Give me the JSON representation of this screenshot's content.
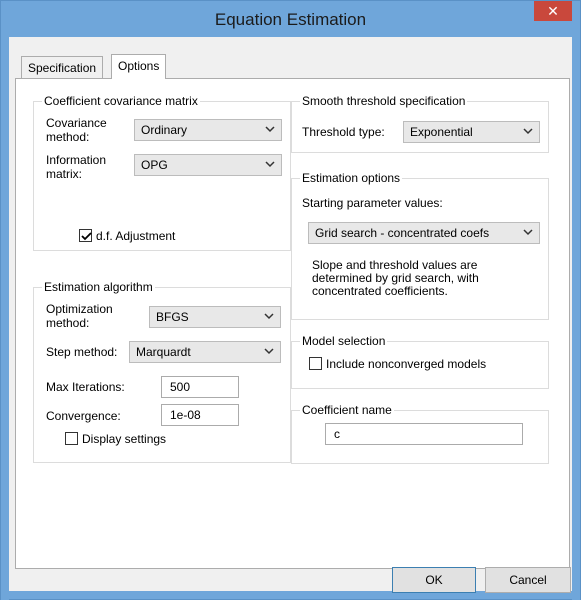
{
  "window": {
    "title": "Equation Estimation"
  },
  "tabs": [
    {
      "label": "Specification",
      "active": false
    },
    {
      "label": "Options",
      "active": true
    }
  ],
  "covariance": {
    "group_label": "Coefficient covariance matrix",
    "method_label_line1": "Covariance",
    "method_label_line2": "method:",
    "method_value": "Ordinary",
    "info_label_line1": "Information",
    "info_label_line2": "matrix:",
    "info_value": "OPG",
    "df_label": "d.f. Adjustment",
    "df_checked": true
  },
  "algorithm": {
    "group_label": "Estimation algorithm",
    "opt_label_line1": "Optimization",
    "opt_label_line2": "method:",
    "opt_value": "BFGS",
    "step_label": "Step method:",
    "step_value": "Marquardt",
    "maxiter_label": "Max Iterations:",
    "maxiter_value": "500",
    "conv_label": "Convergence:",
    "conv_value": "1e-08",
    "display_label": "Display settings",
    "display_checked": false
  },
  "threshold": {
    "group_label": "Smooth threshold specification",
    "type_label": "Threshold type:",
    "type_value": "Exponential"
  },
  "estimation_options": {
    "group_label": "Estimation options",
    "start_label": "Starting parameter values:",
    "start_value": "Grid search - concentrated coefs",
    "desc_line1": "Slope and threshold values are",
    "desc_line2": "determined by grid search, with",
    "desc_line3": "concentrated coefficients."
  },
  "model_selection": {
    "group_label": "Model selection",
    "include_label": "Include nonconverged models",
    "include_checked": false
  },
  "coef_name": {
    "group_label": "Coefficient name",
    "value": "c"
  },
  "buttons": {
    "ok": "OK",
    "cancel": "Cancel"
  },
  "icons": {
    "close": "close-icon",
    "dropdown": "chevron-down-icon",
    "check": "checkmark-icon"
  }
}
